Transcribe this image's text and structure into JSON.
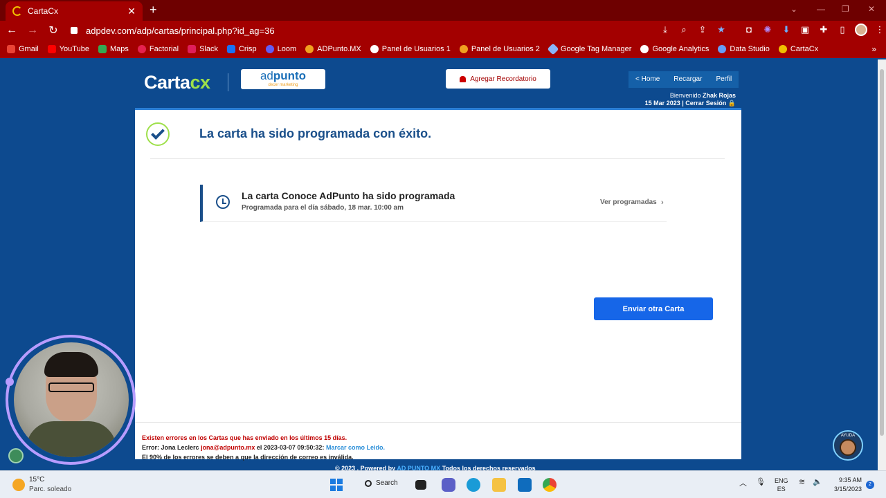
{
  "browser": {
    "tab_title": "CartaCx",
    "url": "adpdev.com/adp/cartas/principal.php?id_ag=36",
    "bookmarks": [
      {
        "label": "Gmail",
        "color": "#ea4335"
      },
      {
        "label": "YouTube",
        "color": "#ff0000"
      },
      {
        "label": "Maps",
        "color": "#34a853"
      },
      {
        "label": "Factorial",
        "color": "#e5214f"
      },
      {
        "label": "Slack",
        "color": "#4a154b"
      },
      {
        "label": "Crisp",
        "color": "#1972f5"
      },
      {
        "label": "Loom",
        "color": "#625df5"
      },
      {
        "label": "ADPunto.MX",
        "color": "#f0a020"
      },
      {
        "label": "Panel de Usuarios 1",
        "color": "#ffffff"
      },
      {
        "label": "Panel de Usuarios 2",
        "color": "#f0a020"
      },
      {
        "label": "Google Tag Manager",
        "color": "#8ab4f8"
      },
      {
        "label": "Google Analytics",
        "color": "#ffffff"
      },
      {
        "label": "Data Studio",
        "color": "#669df6"
      },
      {
        "label": "CartaCx",
        "color": "#f0c000"
      }
    ]
  },
  "header": {
    "logo_main": "Carta",
    "logo_accent": "cx",
    "partner_name_light": "ad",
    "partner_name_bold": "punto",
    "partner_tagline": "decer marketing",
    "reminder_label": "Agregar Recordatorio",
    "nav": [
      "< Home",
      "Recargar",
      "Perfil"
    ],
    "welcome_prefix": "Bienvenido",
    "user_name": "Zhak Rojas",
    "date_logout": "15 Mar 2023 | Cerrar Sesión"
  },
  "main": {
    "success_title": "La carta ha sido programada con éxito.",
    "schedule_title": "La carta Conoce AdPunto ha sido programada",
    "schedule_sub": "Programada para el día sábado, 18 mar. 10:00 am",
    "view_scheduled": "Ver programadas",
    "send_another": "Enviar otra Carta"
  },
  "errors": {
    "headline": "Existen errores en los Cartas que has enviado en los últimos 15 días.",
    "line_prefix": "Error: Jona Leclerc",
    "line_email": "jona@adpunto.mx",
    "line_time": "el 2023-03-07 09:50:32:",
    "mark_read": "Marcar como Leido.",
    "note": "El 90% de los errores se deben a que la dirección de correo es inválida."
  },
  "footer": {
    "prefix": "© 2023 . Powered by",
    "link": "AD PUNTO MX",
    "suffix": "Todos los derechos reservados"
  },
  "help_label": "AYUDA",
  "taskbar": {
    "temp": "15°C",
    "weather": "Parc. soleado",
    "search": "Search",
    "lang_top": "ENG",
    "lang_bottom": "ES",
    "time": "9:35 AM",
    "date": "3/15/2023",
    "notifications": "2"
  }
}
